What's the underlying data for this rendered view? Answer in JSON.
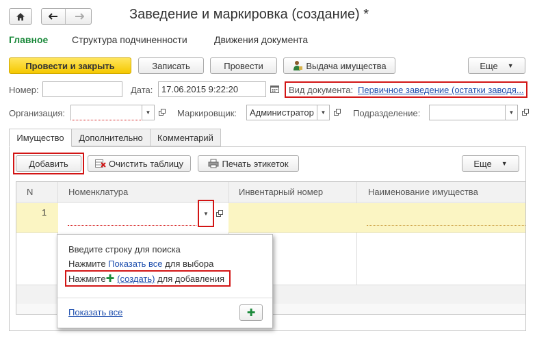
{
  "window": {
    "title": "Заведение и маркировка (создание) *"
  },
  "nav_tabs": [
    {
      "label": "Главное"
    },
    {
      "label": "Структура подчиненности"
    },
    {
      "label": "Движения документа"
    }
  ],
  "toolbar": {
    "post_close": "Провести и закрыть",
    "save": "Записать",
    "post": "Провести",
    "issue": "Выдача имущества",
    "more": "Еще"
  },
  "header": {
    "number_label": "Номер:",
    "number_value": "",
    "date_label": "Дата:",
    "date_value": "17.06.2015  9:22:20",
    "doc_type_label": "Вид документа:",
    "doc_type_value": "Первичное заведение (остатки заводя..."
  },
  "org_row": {
    "org_label": "Организация:",
    "org_value": "",
    "marker_label": "Маркировщик:",
    "marker_value": "Администратор",
    "dept_label": "Подразделение:",
    "dept_value": ""
  },
  "content_tabs": [
    {
      "label": "Имущество"
    },
    {
      "label": "Дополнительно"
    },
    {
      "label": "Комментарий"
    }
  ],
  "table_toolbar": {
    "add": "Добавить",
    "clear": "Очистить таблицу",
    "print_labels": "Печать этикеток",
    "more": "Еще"
  },
  "table": {
    "columns": [
      "N",
      "Номенклатура",
      "Инвентарный номер",
      "Наименование имущества"
    ],
    "rows": [
      {
        "n": "1",
        "nomenclature": "",
        "inventory": "",
        "name": ""
      }
    ]
  },
  "popup": {
    "line1": "Введите строку для поиска",
    "line2_prefix": "Нажмите ",
    "line2_link": "Показать все",
    "line2_suffix": " для выбора",
    "line3_prefix": "Нажмите ",
    "line3_link": "(создать)",
    "line3_suffix": " для добавления",
    "show_all": "Показать все"
  },
  "colors": {
    "accent_green": "#1c8a3c",
    "link_blue": "#1f4fae",
    "highlight_red": "#d21414",
    "row_yellow": "#fbf5c3",
    "primary_yellow": "#f5c800"
  }
}
